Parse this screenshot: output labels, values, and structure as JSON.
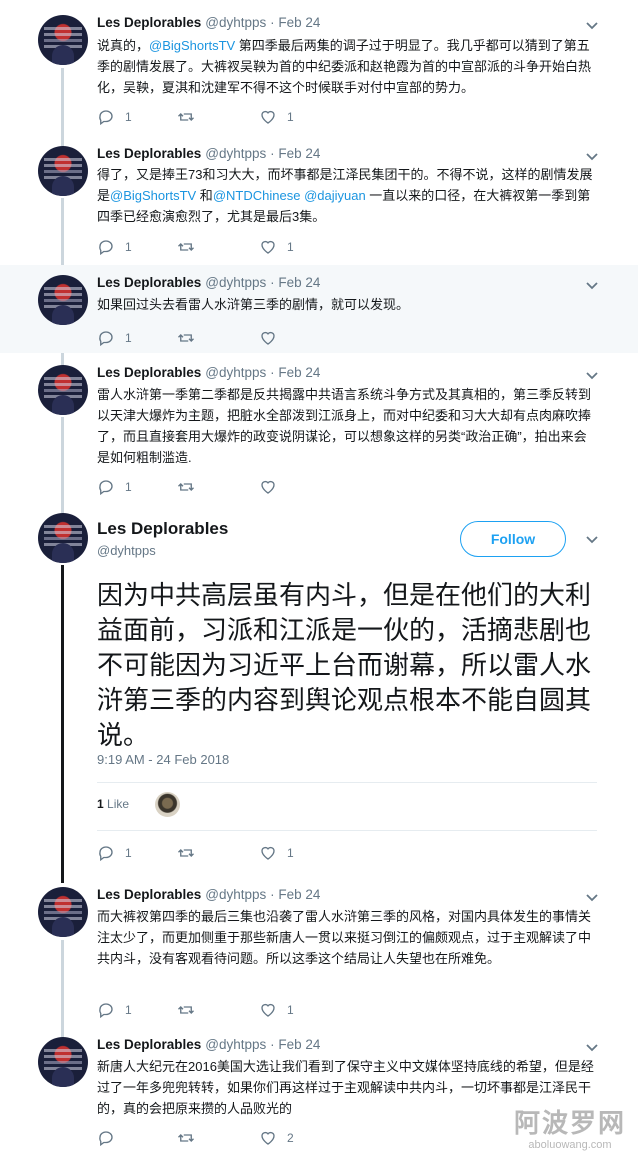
{
  "tweets": [
    {
      "name": "Les Deplorables",
      "handle": "@dyhtpps",
      "sep": "·",
      "date": "Feb 24",
      "text_a": "说真的，",
      "link_a": "@BigShortsTV",
      "text_b": " 第四季最后两集的调子过于明显了。我几乎都可以猜到了第五季的剧情发展了。大裤衩吴鞅为首的中纪委派和赵艳霞为首的中宣部派的斗争开始白热化，吴鞅，夏淇和沈建军不得不这个时候联手对付中宣部的势力。",
      "replies": "1",
      "retweets": "",
      "likes": "1"
    },
    {
      "name": "Les Deplorables",
      "handle": "@dyhtpps",
      "sep": "·",
      "date": "Feb 24",
      "text_a": "得了，又是捧王73和习大大，而坏事都是江泽民集团干的。不得不说，这样的剧情发展是",
      "link_a": "@BigShortsTV",
      "text_b": " 和",
      "link_b": "@NTDChinese",
      "text_c": " ",
      "link_c": "@dajiyuan",
      "text_d": " 一直以来的口径，在大裤衩第一季到第四季已经愈演愈烈了，尤其是最后3集。",
      "replies": "1",
      "retweets": "",
      "likes": "1"
    },
    {
      "name": "Les Deplorables",
      "handle": "@dyhtpps",
      "sep": "·",
      "date": "Feb 24",
      "text_a": "如果回过头去看雷人水浒第三季的剧情，就可以发现。",
      "replies": "1",
      "retweets": "",
      "likes": ""
    },
    {
      "name": "Les Deplorables",
      "handle": "@dyhtpps",
      "sep": "·",
      "date": "Feb 24",
      "text_a": "雷人水浒第一季第二季都是反共揭露中共语言系统斗争方式及其真相的，第三季反转到以天津大爆炸为主题，把脏水全部泼到江派身上，而对中纪委和习大大却有点肉麻吹捧了，而且直接套用大爆炸的政变说阴谋论，可以想象这样的另类“政治正确”，拍出来会是如何粗制滥造.",
      "replies": "1",
      "retweets": "",
      "likes": ""
    }
  ],
  "focused": {
    "name": "Les Deplorables",
    "handle": "@dyhtpps",
    "follow_label": "Follow",
    "text": "因为中共高层虽有内斗，但是在他们的大利益面前，习派和江派是一伙的，活摘悲剧也不可能因为习近平上台而谢幕，所以雷人水浒第三季的内容到舆论观点根本不能自圆其说。",
    "timestamp": "9:19 AM - 24 Feb 2018",
    "like_count": "1",
    "like_label": "Like",
    "replies": "1",
    "retweets": "",
    "likes": "1"
  },
  "after": [
    {
      "name": "Les Deplorables",
      "handle": "@dyhtpps",
      "sep": "·",
      "date": "Feb 24",
      "text_a": "而大裤衩第四季的最后三集也沿袭了雷人水浒第三季的风格，对国内具体发生的事情关注太少了，而更加侧重于那些新唐人一贯以来挺习倒江的偏颇观点，过于主观解读了中共内斗，没有客观看待问题。所以这季这个结局让人失望也在所难免。",
      "replies": "1",
      "retweets": "",
      "likes": "1"
    },
    {
      "name": "Les Deplorables",
      "handle": "@dyhtpps",
      "sep": "·",
      "date": "Feb 24",
      "text_a": "新唐人大纪元在2016美国大选让我们看到了保守主义中文媒体坚持底线的希望，但是经过了一年多兜兜转转，如果你们再这样过于主观解读中共内斗，一切坏事都是江泽民干的，真的会把原来攒的人品败光的",
      "replies": "",
      "retweets": "",
      "likes": "2"
    }
  ],
  "watermark": {
    "line1": "阿波罗网",
    "line2": "aboluowang.com"
  },
  "colors": {
    "link": "#1b95e0",
    "muted": "#657786",
    "follow": "#1da1f2",
    "highlight_bg": "#f5f8fa"
  },
  "icons": [
    "reply-icon",
    "retweet-icon",
    "heart-icon",
    "chevron-down-icon"
  ]
}
